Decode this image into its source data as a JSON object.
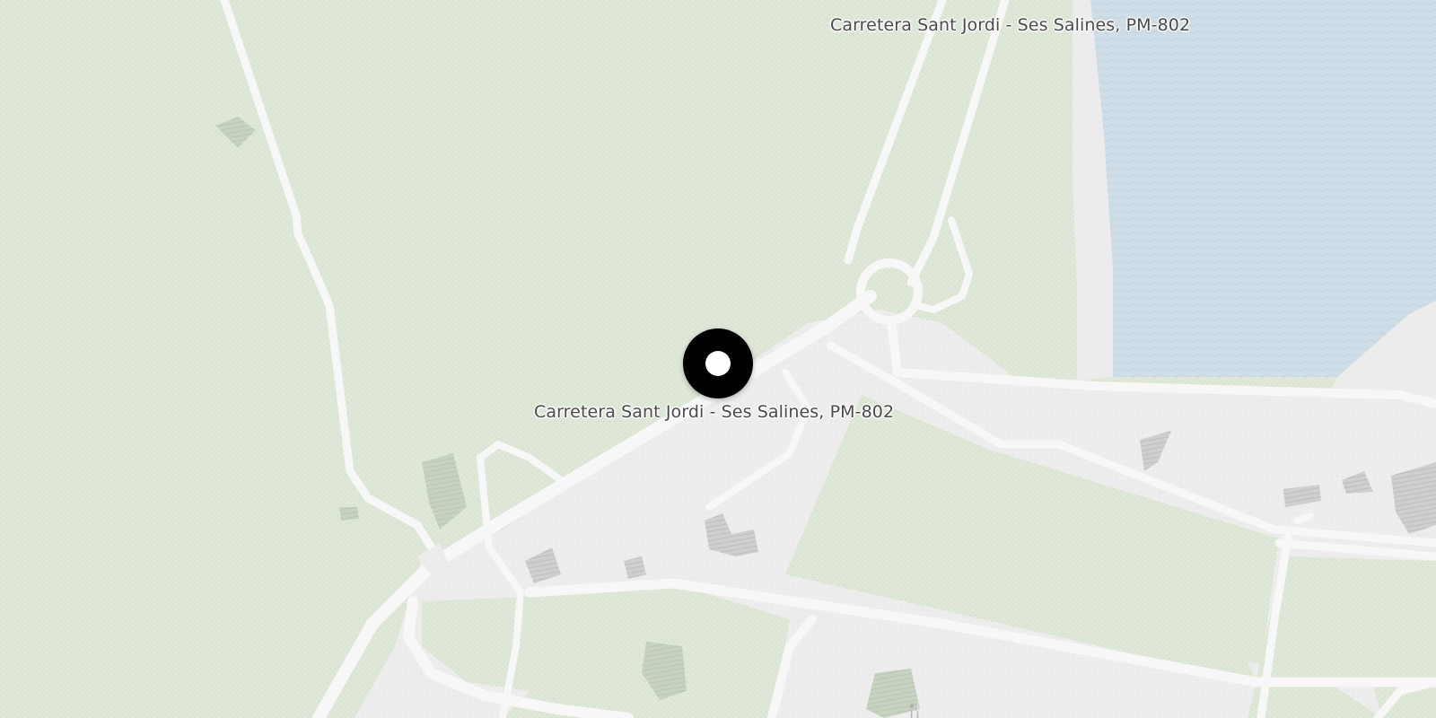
{
  "map": {
    "labels": {
      "road_top": "Carretera Sant Jordi - Ses Salines, PM-802",
      "road_main": "Carretera Sant Jordi - Ses Salines, PM-802"
    },
    "marker": {
      "icon": "location-pin-icon"
    },
    "poi": {
      "icon": "restaurant-icon"
    },
    "colors": {
      "land": "#dfe8d8",
      "water": "#cfdde6",
      "urban": "#ececec",
      "road": "#f7f7f7",
      "building": "#c9c9c9",
      "marker": "#000000"
    }
  }
}
